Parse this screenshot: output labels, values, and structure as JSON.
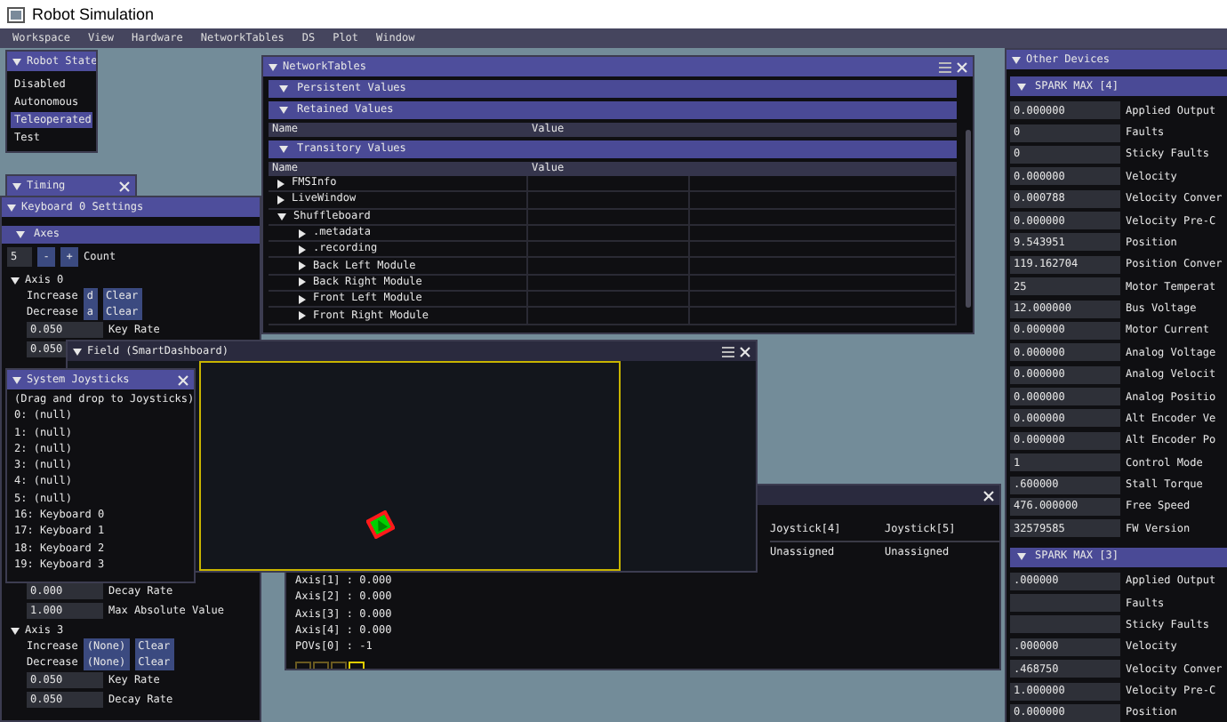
{
  "window": {
    "title": "Robot Simulation"
  },
  "menu": [
    "Workspace",
    "View",
    "Hardware",
    "NetworkTables",
    "DS",
    "Plot",
    "Window"
  ],
  "robot_state": {
    "title": "Robot State",
    "modes": [
      {
        "label": "Disabled",
        "selected": false
      },
      {
        "label": "Autonomous",
        "selected": false
      },
      {
        "label": "Teleoperated",
        "selected": true
      },
      {
        "label": "Test",
        "selected": false
      }
    ]
  },
  "timing": {
    "title": "Timing"
  },
  "keyboard_settings": {
    "title": "Keyboard 0 Settings",
    "axes_header": "Axes",
    "count": "5",
    "minus": "-",
    "plus": "+",
    "count_label": "Count",
    "rows": [
      {
        "kind": "axis",
        "name": "Axis 0",
        "expanded": true
      },
      {
        "kind": "key",
        "action": "Increase",
        "key": "d",
        "button": "Clear"
      },
      {
        "kind": "key",
        "action": "Decrease",
        "key": "a",
        "button": "Clear"
      },
      {
        "kind": "value",
        "value": "0.050",
        "label": "Key Rate"
      },
      {
        "kind": "value",
        "value": "0.050"
      }
    ],
    "rows_lower": [
      {
        "kind": "value",
        "value": "0.000",
        "label": "Decay Rate"
      },
      {
        "kind": "value",
        "value": "1.000",
        "label": "Max Absolute Value"
      },
      {
        "kind": "axis",
        "name": "Axis 3",
        "expanded": true
      },
      {
        "kind": "key",
        "action": "Increase",
        "key": "(None)",
        "button": "Clear"
      },
      {
        "kind": "key",
        "action": "Decrease",
        "key": "(None)",
        "button": "Clear"
      },
      {
        "kind": "value",
        "value": "0.050",
        "label": "Key Rate"
      },
      {
        "kind": "value",
        "value": "0.050",
        "label": "Decay Rate"
      }
    ]
  },
  "joysticks": {
    "columns": [
      {
        "header": "Joystick[4]",
        "assignment": "Unassigned"
      },
      {
        "header": "Joystick[5]",
        "assignment": "Unassigned"
      }
    ],
    "readings": [
      "Axis[1] : 0.000",
      "Axis[2] : 0.000",
      "Axis[3] : 0.000",
      "Axis[4] : 0.000",
      "POVs[0] : -1"
    ],
    "buttons": [
      {
        "on": false
      },
      {
        "on": false
      },
      {
        "on": false
      },
      {
        "on": true
      }
    ]
  },
  "field": {
    "title": "Field (SmartDashboard)"
  },
  "system_joysticks": {
    "title": "System Joysticks",
    "hint": "(Drag and drop to Joysticks)",
    "items": [
      "0: (null)",
      "1: (null)",
      "2: (null)",
      "3: (null)",
      "4: (null)",
      "5: (null)",
      "16: Keyboard 0",
      "17: Keyboard 1",
      "18: Keyboard 2",
      "19: Keyboard 3"
    ]
  },
  "network_tables": {
    "title": "NetworkTables",
    "sections": [
      {
        "title": "Persistent Values",
        "expanded": true
      },
      {
        "title": "Retained Values",
        "expanded": true,
        "columns": [
          "Name",
          "Value"
        ]
      },
      {
        "title": "Transitory Values",
        "expanded": true,
        "columns": [
          "Name",
          "Value"
        ],
        "tree": [
          {
            "name": "FMSInfo",
            "expanded": false
          },
          {
            "name": "LiveWindow",
            "expanded": false
          },
          {
            "name": "Shuffleboard",
            "expanded": true,
            "children": [
              {
                "name": ".metadata",
                "expanded": false
              },
              {
                "name": ".recording",
                "expanded": false
              },
              {
                "name": "Back Left Module",
                "expanded": false
              },
              {
                "name": "Back Right Module",
                "expanded": false
              },
              {
                "name": "Front Left Module",
                "expanded": false
              },
              {
                "name": "Front Right Module",
                "expanded": false
              }
            ]
          }
        ]
      }
    ]
  },
  "other_devices": {
    "title": "Other Devices",
    "devices": [
      {
        "name": "SPARK MAX [4]",
        "expanded": true,
        "rows": [
          {
            "value": "0.000000",
            "label": "Applied Output"
          },
          {
            "value": "0",
            "label": "Faults"
          },
          {
            "value": "0",
            "label": "Sticky Faults"
          },
          {
            "value": "0.000000",
            "label": "Velocity"
          },
          {
            "value": "0.000788",
            "label": "Velocity Conver"
          },
          {
            "value": "0.000000",
            "label": "Velocity Pre-C"
          },
          {
            "value": "9.543951",
            "label": "Position"
          },
          {
            "value": "119.162704",
            "label": "Position Conver"
          },
          {
            "value": "25",
            "label": "Motor Temperat"
          },
          {
            "value": "12.000000",
            "label": "Bus Voltage"
          },
          {
            "value": "0.000000",
            "label": "Motor Current"
          },
          {
            "value": "0.000000",
            "label": "Analog Voltage"
          },
          {
            "value": "0.000000",
            "label": "Analog Velocit"
          },
          {
            "value": "0.000000",
            "label": "Analog Positio"
          },
          {
            "value": "0.000000",
            "label": "Alt Encoder Ve"
          },
          {
            "value": "0.000000",
            "label": "Alt Encoder Po"
          },
          {
            "value": "1",
            "label": "Control Mode"
          },
          {
            "value": ".600000",
            "label": "Stall Torque"
          },
          {
            "value": "476.000000",
            "label": "Free Speed"
          },
          {
            "value": "32579585",
            "label": "FW Version"
          }
        ]
      },
      {
        "name": "SPARK MAX [3]",
        "expanded": true,
        "rows": [
          {
            "value": ".000000",
            "label": "Applied Output"
          },
          {
            "label": "Faults"
          },
          {
            "label": "Sticky Faults"
          },
          {
            "value": ".000000",
            "label": "Velocity"
          },
          {
            "value": ".468750",
            "label": "Velocity Conver"
          },
          {
            "value": "1.000000",
            "label": "Velocity Pre-C"
          },
          {
            "value": "0.000000",
            "label": "Position"
          }
        ]
      }
    ]
  }
}
